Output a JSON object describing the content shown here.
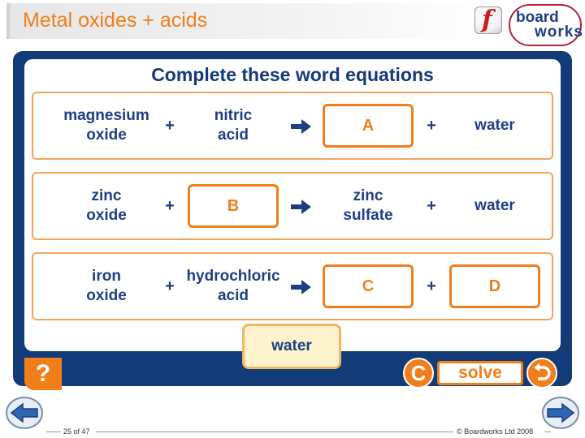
{
  "header": {
    "title": "Metal oxides + acids",
    "logo_brand_line1": "board",
    "logo_brand_line2": "works",
    "flash_logo_glyph": "f"
  },
  "activity": {
    "heading": "Complete these word equations",
    "plus": "+",
    "arrow_icon": "arrow-right-icon",
    "equations": [
      {
        "reactant1": "magnesium\noxide",
        "reactant2": "nitric\nacid",
        "product1": "A",
        "product2": "water"
      },
      {
        "reactant1": "zinc\noxide",
        "reactant2": "B",
        "product1": "zinc\nsulfate",
        "product2": "water"
      },
      {
        "reactant1": "iron\noxide",
        "reactant2": "hydrochloric\nacid",
        "product1": "C",
        "product2": "D"
      }
    ],
    "answer_tile": "water"
  },
  "controls": {
    "help_label": "?",
    "clear_label": "C",
    "solve_label": "solve",
    "undo_icon": "undo-arrow-icon"
  },
  "footer": {
    "page_count": "25 of 47",
    "copyright": "© Boardworks Ltd 2008"
  },
  "colors": {
    "accent_orange": "#f07e1b",
    "navy": "#133b78",
    "text_blue": "#1e3f84",
    "tile_fill": "#fdf3cc"
  }
}
